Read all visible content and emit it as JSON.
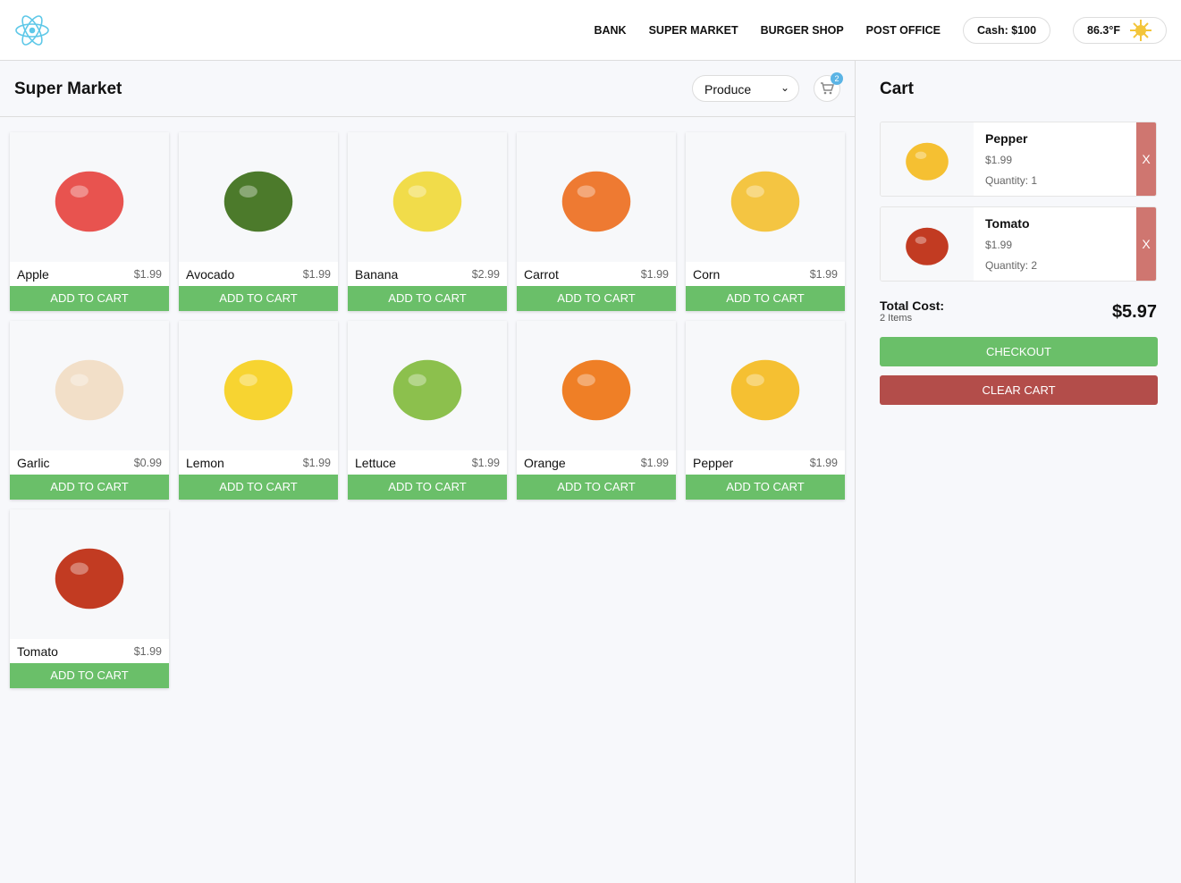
{
  "header": {
    "nav": [
      "BANK",
      "SUPER MARKET",
      "BURGER SHOP",
      "POST OFFICE"
    ],
    "cash": "Cash: $100",
    "weather": "86.3°F"
  },
  "market": {
    "title": "Super Market",
    "category": "Produce",
    "cart_count": "2",
    "add_label": "ADD TO CART",
    "products": [
      {
        "name": "Apple",
        "price": "$1.99",
        "color": "#e8534f"
      },
      {
        "name": "Avocado",
        "price": "$1.99",
        "color": "#4c7a2b"
      },
      {
        "name": "Banana",
        "price": "$2.99",
        "color": "#f1dc4a"
      },
      {
        "name": "Carrot",
        "price": "$1.99",
        "color": "#ee7a32"
      },
      {
        "name": "Corn",
        "price": "$1.99",
        "color": "#f4c542"
      },
      {
        "name": "Garlic",
        "price": "$0.99",
        "color": "#f2dfc8"
      },
      {
        "name": "Lemon",
        "price": "$1.99",
        "color": "#f7d431"
      },
      {
        "name": "Lettuce",
        "price": "$1.99",
        "color": "#8cc04d"
      },
      {
        "name": "Orange",
        "price": "$1.99",
        "color": "#ef7f26"
      },
      {
        "name": "Pepper",
        "price": "$1.99",
        "color": "#f5c032"
      },
      {
        "name": "Tomato",
        "price": "$1.99",
        "color": "#c23b22"
      }
    ]
  },
  "cart": {
    "title": "Cart",
    "remove_label": "X",
    "items": [
      {
        "name": "Pepper",
        "price": "$1.99",
        "qty": "Quantity: 1",
        "color": "#f5c032"
      },
      {
        "name": "Tomato",
        "price": "$1.99",
        "qty": "Quantity: 2",
        "color": "#c23b22"
      }
    ],
    "total_label": "Total Cost:",
    "items_count": "2 Items",
    "total": "$5.97",
    "checkout": "CHECKOUT",
    "clear": "CLEAR CART"
  }
}
